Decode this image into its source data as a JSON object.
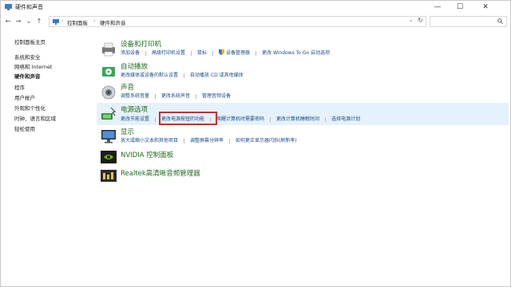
{
  "window": {
    "title": "硬件和声音",
    "minimize": "—",
    "maximize": "☐",
    "close": "✕"
  },
  "nav": {
    "back": "←",
    "forward": "→",
    "recent": "⌄",
    "up": "↑",
    "breadcrumb": [
      "控制面板",
      "硬件和声音"
    ],
    "separator": "›",
    "dropdown": "⌄",
    "refresh": "↻",
    "search_placeholder": ""
  },
  "sidebar": {
    "home": "控制面板主页",
    "items": [
      {
        "label": "系统和安全"
      },
      {
        "label": "网络和 Internet"
      },
      {
        "label": "硬件和声音",
        "active": true
      },
      {
        "label": "程序"
      },
      {
        "label": "用户帐户"
      },
      {
        "label": "外观和个性化"
      },
      {
        "label": "时钟、语言和区域"
      },
      {
        "label": "轻松使用"
      }
    ]
  },
  "categories": [
    {
      "title": "设备和打印机",
      "icon": "printer-icon",
      "links": [
        "添加设备",
        "高级打印机设置",
        "鼠标",
        "设备管理器",
        "更改 Windows To Go 启动选项"
      ]
    },
    {
      "title": "自动播放",
      "icon": "autoplay-icon",
      "links": [
        "更改媒体或设备的默认设置",
        "自动播放 CD 或其他媒体"
      ]
    },
    {
      "title": "声音",
      "icon": "speaker-icon",
      "links": [
        "调整系统音量",
        "更改系统声音",
        "管理音频设备"
      ]
    },
    {
      "title": "电源选项",
      "icon": "power-options-icon",
      "links": [
        "更改节能设置",
        "更改电源按钮的功能",
        "唤醒计算机时需要密码",
        "更改计算机睡眠时间",
        "选择电源计划"
      ],
      "highlighted": true
    },
    {
      "title": "显示",
      "icon": "display-icon",
      "links": [
        "放大或缩小文本和其他项目",
        "调整屏幕分辨率",
        "如何更正显示器闪烁(刷新率)"
      ]
    },
    {
      "title": "NVIDIA 控制面板",
      "icon": "nvidia-icon",
      "links": []
    },
    {
      "title": "Realtek高清晰音频管理器",
      "icon": "realtek-icon",
      "links": []
    }
  ],
  "colors": {
    "category_title": "#1e6e1e",
    "link": "#1a4a8a",
    "highlight_bg": "#e5f1fb",
    "annotation_box": "#d9262b"
  }
}
